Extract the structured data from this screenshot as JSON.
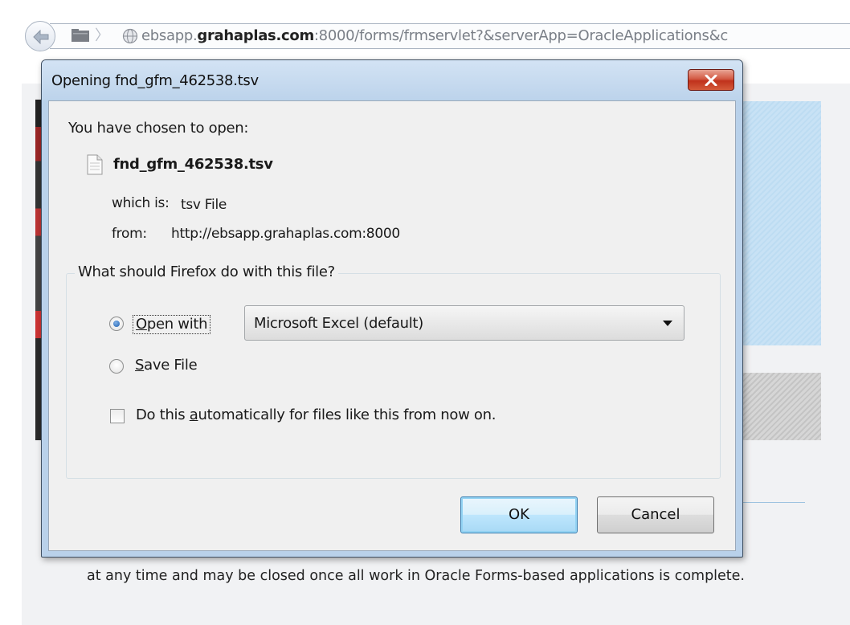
{
  "browser": {
    "url_prefix": "ebsapp.",
    "url_domain": "grahaplas.com",
    "url_rest": ":8000/forms/frmservlet?&serverApp=OracleApplications&c"
  },
  "background_page": {
    "text": "at any time and may be closed once all work in Oracle Forms-based applications is complete."
  },
  "dialog": {
    "title": "Opening fnd_gfm_462538.tsv",
    "chosen_label": "You have chosen to open:",
    "filename": "fnd_gfm_462538.tsv",
    "which_is_label": "which is:",
    "which_is_value": "tsv File",
    "from_label": "from:",
    "from_value": "http://ebsapp.grahaplas.com:8000",
    "group_legend": "What should Firefox do with this file?",
    "open_with": {
      "prefix": "",
      "accel": "O",
      "rest": "pen with",
      "selected": true
    },
    "save_file": {
      "accel": "S",
      "rest": "ave File",
      "selected": false
    },
    "app_select_value": "Microsoft Excel (default)",
    "auto": {
      "before": "Do this ",
      "accel": "a",
      "after": "utomatically for files like this from now on.",
      "checked": false
    },
    "ok_label": "OK",
    "cancel_label": "Cancel"
  }
}
